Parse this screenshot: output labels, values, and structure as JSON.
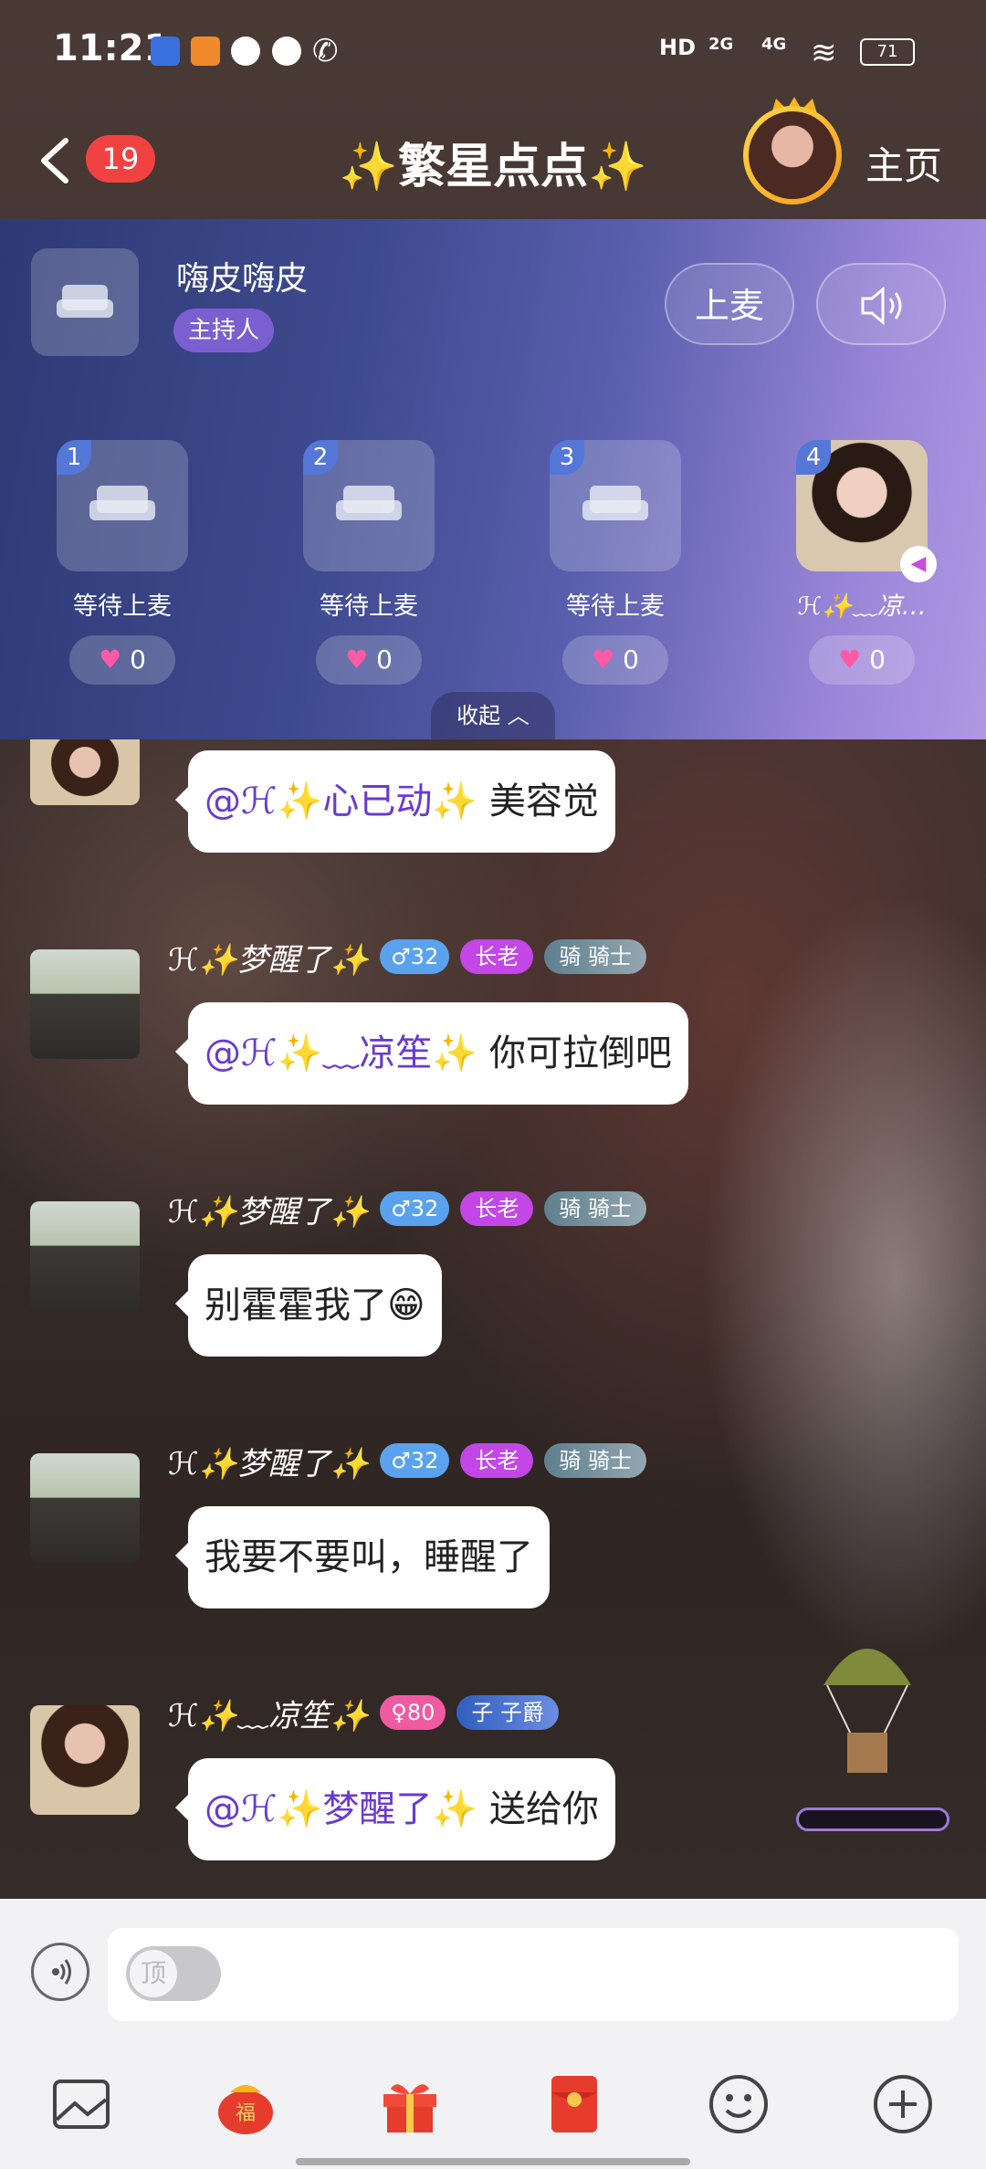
{
  "status_bar": {
    "time": "11:21",
    "battery": "71",
    "net1": "2G",
    "net2": "4G"
  },
  "header": {
    "back_count": "19",
    "room_title": "✨繁星点点✨",
    "home_label": "主页"
  },
  "stage": {
    "host_name": "嗨皮嗨皮",
    "host_tag": "主持人",
    "mic_button": "上麦",
    "seats": [
      {
        "num": "1",
        "label": "等待上麦",
        "likes": "0"
      },
      {
        "num": "2",
        "label": "等待上麦",
        "likes": "0"
      },
      {
        "num": "3",
        "label": "等待上麦",
        "likes": "0"
      },
      {
        "num": "4",
        "label": "ℋ✨﹏凉…",
        "likes": "0"
      }
    ],
    "collapse_label": "收起"
  },
  "messages": [
    {
      "mention": "@ℋ✨心已动✨",
      "text": " 美容觉"
    },
    {
      "nick": "ℋ✨梦醒了✨",
      "level": "♂32",
      "role": "长老",
      "rank_icon": "骑",
      "rank": "骑士",
      "mention": "@ℋ✨﹏凉笙✨",
      "text": " 你可拉倒吧"
    },
    {
      "nick": "ℋ✨梦醒了✨",
      "level": "♂32",
      "role": "长老",
      "rank_icon": "骑",
      "rank": "骑士",
      "text": "别霍霍我了😁"
    },
    {
      "nick": "ℋ✨梦醒了✨",
      "level": "♂32",
      "role": "长老",
      "rank_icon": "骑",
      "rank": "骑士",
      "text": "我要不要叫，睡醒了"
    },
    {
      "nick": "ℋ✨﹏凉笙✨",
      "level": "♀80",
      "rank_icon": "子",
      "rank": "子爵",
      "mention": "@ℋ✨梦醒了✨",
      "text": " 送给你"
    }
  ],
  "input": {
    "toggle_label": "顶"
  },
  "colors": {
    "accent": "#6a3ad0",
    "badge_red": "#f24141",
    "role_purple": "#c247e6"
  },
  "icons": [
    "back-icon",
    "speaker-icon",
    "voice-icon",
    "image-icon",
    "lucky-bag-icon",
    "gift-icon",
    "red-packet-icon",
    "emoji-icon",
    "plus-icon",
    "parachute-icon"
  ]
}
